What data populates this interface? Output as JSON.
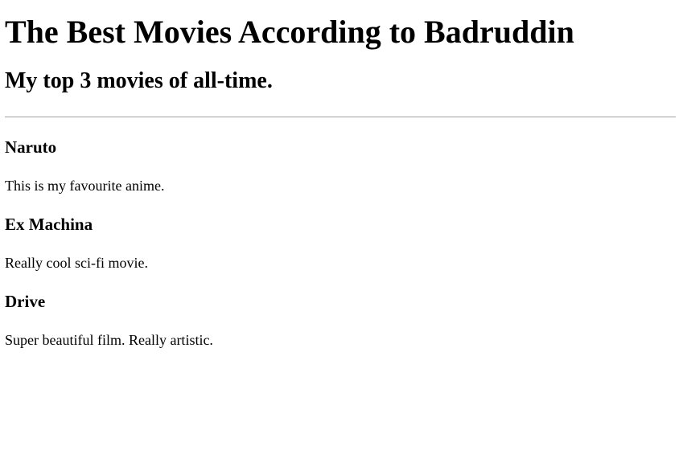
{
  "header": {
    "title": "The Best Movies According to Badruddin",
    "subtitle": "My top 3 movies of all-time."
  },
  "movies": [
    {
      "title": "Naruto",
      "description": "This is my favourite anime."
    },
    {
      "title": "Ex Machina",
      "description": "Really cool sci-fi movie."
    },
    {
      "title": "Drive",
      "description": "Super beautiful film. Really artistic."
    }
  ]
}
